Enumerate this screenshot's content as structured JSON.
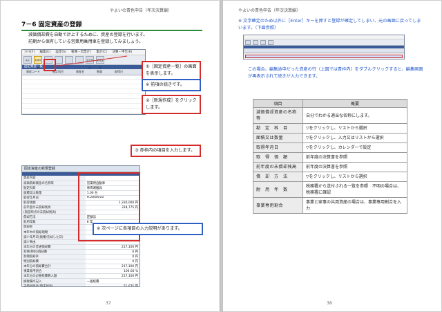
{
  "header": {
    "left": "やよいの青色申告（年次決算編）",
    "right": "やよいの青色申告（年次決算編）"
  },
  "pages": {
    "left": "37",
    "right": "38"
  },
  "section_title": "7－6 固定資産の登録",
  "intro": [
    "減価償却費を自動で計上するために、資産の登録を行います。",
    "前期から保有している営業用乗用車を登録してみましょう。"
  ],
  "app": {
    "menus": [
      "ﾌｧｲﾙ(F)",
      "編集(E)",
      "設定(S)",
      "帳簿・伝票(T)",
      "集計(C)",
      "決算・申告(K)",
      "ｳｨﾝﾄﾞｳ(W)",
      "ﾍﾙﾌﾟ(H)"
    ],
    "toolbar": [
      "戻る",
      "新規作成",
      "",
      "",
      "",
      "",
      "表示設定",
      "項目設定"
    ],
    "list_title": "固定資産一覧",
    "list_cols": [
      "資産コード",
      "勘定科目",
      "資産名",
      "数量",
      "取得日"
    ]
  },
  "callouts": {
    "c1": "①［固定資産一覧］の画面を表示します。",
    "c_prev": "※ 前項の続きです。",
    "c2": "②［新規作成］をクリックします。",
    "c3": "③ 赤枠内の項目を入力します。",
    "c_next": "※ 次ページに各項目の入力説明があります。"
  },
  "register": {
    "title": "固定資産の新規登録",
    "band": "資産内容・取得価額等の入力",
    "rows": [
      {
        "k": "資産内容",
        "v": ""
      },
      {
        "k": "減価償却資産の名称等",
        "v": "営業用自動車"
      },
      {
        "k": "勘定科目",
        "v": "車両運搬具"
      },
      {
        "k": "面積又は数量",
        "v": "1.00 台"
      },
      {
        "k": "取得年月日",
        "v": "H.28/04/10"
      },
      {
        "k": "取得価額",
        "v": "1,330,000 円"
      },
      {
        "k": "前年度の未償却残高",
        "v": "318,775 円"
      },
      {
        "k": "(期首時点の未償却残高)",
        "v": ""
      },
      {
        "k": "償却方法",
        "v": "定額法"
      },
      {
        "k": "耐用年数",
        "v": "6 年"
      },
      {
        "k": "償却率",
        "v": "0.167"
      },
      {
        "k": "本年中の償却期間",
        "v": ""
      },
      {
        "k": "減少年月日(廃棄/売却した日)",
        "v": ""
      },
      {
        "k": "減少事由",
        "v": ""
      },
      {
        "k": "本年分の普通償却費",
        "v": "217,100 円"
      },
      {
        "k": "割増(特別)償却費",
        "v": "0 円"
      },
      {
        "k": "割増償却率",
        "v": "0 円"
      },
      {
        "k": "特別償却費",
        "v": "0 円"
      },
      {
        "k": "本年分の償却費合計",
        "v": "217,100 円"
      },
      {
        "k": "事業専用割合",
        "v": "100.00 %"
      },
      {
        "k": "本年分の必要経費算入額",
        "v": "217,100 円"
      },
      {
        "k": "摘要欄の記入",
        "v": "一般経費"
      },
      {
        "k": "未償却残高(期末残高)",
        "v": "51,675 円"
      }
    ]
  },
  "right_notes": {
    "note1": "※ 文字確定のため以外に［Enter］キーを押すと登録が確定してしまい、元の画面に戻ってしまいます。（下図参照）",
    "note2": "この場合、編集途中だった資産の行（上図では青枠内）をダブルクリックすると、編集画面が再表示されて続きが入力できます。"
  },
  "desc_table": {
    "head": [
      "項目",
      "概要"
    ],
    "rows": [
      [
        "減価償却資産の名称等",
        "自分でわかる適当な名称にします。"
      ],
      [
        "勘　定　科　目",
        "▽をクリックし、リストから選択"
      ],
      [
        "面積又は数量",
        "▽をクリックし、入力又はリストから選択"
      ],
      [
        "取得年月日",
        "▽をクリックし、カレンダーで設定"
      ],
      [
        "取　得　価　額",
        "前年度の決算書を参照"
      ],
      [
        "前年度の未償却残高",
        "前年度の決算書を参照"
      ],
      [
        "償　却　方　法",
        "▽をクリックし、リストから選択"
      ],
      [
        "耐　用　年　数",
        "税務署から送付される一覧を参照　不明の場合は、税務署に確認"
      ],
      [
        "事業専用割合",
        "事業と家事の共用資産の場合は、事業専用割合を入力"
      ]
    ]
  },
  "colors": {
    "accent_green": "#2a8a3a",
    "callout_red": "#d42a2a",
    "callout_blue": "#2d5fc4",
    "text_blue": "#1f55c8"
  }
}
